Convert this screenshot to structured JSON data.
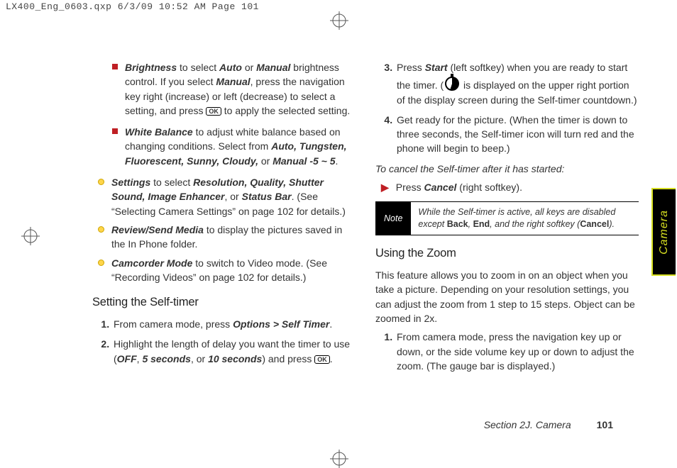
{
  "meta": {
    "press_header": "LX400_Eng_0603.qxp  6/3/09  10:52 AM  Page 101",
    "side_tab": "Camera",
    "footer_section": "Section 2J. Camera",
    "footer_page": "101"
  },
  "col1": {
    "sub1_term": "Brightness",
    "sub1_text_a": " to select ",
    "sub1_opt_a": "Auto",
    "sub1_text_b": " or ",
    "sub1_opt_b": "Manual",
    "sub1_text_c": " brightness control. If you select ",
    "sub1_opt_c": "Manual",
    "sub1_text_d": ", press the navigation key right (increase) or left (decrease) to select a setting, and press ",
    "sub1_text_e": " to apply the selected setting.",
    "sub2_term": "White Balance",
    "sub2_text_a": " to adjust white balance based on changing conditions. Select from ",
    "sub2_opts": "Auto, Tungsten, Fluorescent, Sunny, Cloudy,",
    "sub2_text_b": " or ",
    "sub2_opts2": "Manual -5 ~ 5",
    "sub2_text_c": ".",
    "b1_term": "Settings",
    "b1_text_a": " to select ",
    "b1_opts": "Resolution, Quality, Shutter Sound, Image Enhancer",
    "b1_text_b": ", or ",
    "b1_opts2": "Status Bar",
    "b1_text_c": ". (See “Selecting Camera Settings” on page 102 for details.)",
    "b2_term": "Review/Send Media",
    "b2_text": " to display the pictures saved in the In Phone folder.",
    "b3_term": "Camcorder Mode",
    "b3_text": " to switch to Video mode. (See “Recording Videos” on page 102 for details.)",
    "h_selftimer": "Setting the Self-timer",
    "st1_a": "From camera mode, press ",
    "st1_opts": "Options > Self Timer",
    "st1_b": ".",
    "st2_a": "Highlight the length of delay you want the timer to use (",
    "st2_o1": "OFF",
    "st2_b": ", ",
    "st2_o2": "5 seconds",
    "st2_c": ", or ",
    "st2_o3": "10 seconds",
    "st2_d": ") and press ",
    "st2_e": "."
  },
  "col2": {
    "st3_a": "Press ",
    "st3_k": "Start",
    "st3_b": " (left softkey) when you are ready to start the timer. (",
    "st3_c": " is displayed on the upper right portion of the display screen during the Self-timer countdown.)",
    "st4": "Get ready for the picture. (When the timer is down to three seconds, the Self-timer icon will turn red and the phone will begin to beep.)",
    "cancel_hdr": "To cancel the Self-timer after it has started:",
    "cancel_a": "Press ",
    "cancel_k": "Cancel",
    "cancel_b": " (right softkey).",
    "note_label": "Note",
    "note_a": "While the Self-timer is active, all keys are disabled except ",
    "note_k1": "Back",
    "note_s1": ", ",
    "note_k2": "End",
    "note_s2": ", and the right softkey (",
    "note_k3": "Cancel",
    "note_s3": ").",
    "h_zoom": "Using the Zoom",
    "zoom_p": "This feature allows you to zoom in on an object when you take a picture. Depending on your resolution settings, you can adjust the zoom from 1 step to 15 steps. Object can be zoomed in 2x.",
    "z1": "From camera mode, press the navigation key up or down, or the side volume key up or down to adjust the zoom. (The gauge bar is displayed.)"
  },
  "ok_label": "OK"
}
